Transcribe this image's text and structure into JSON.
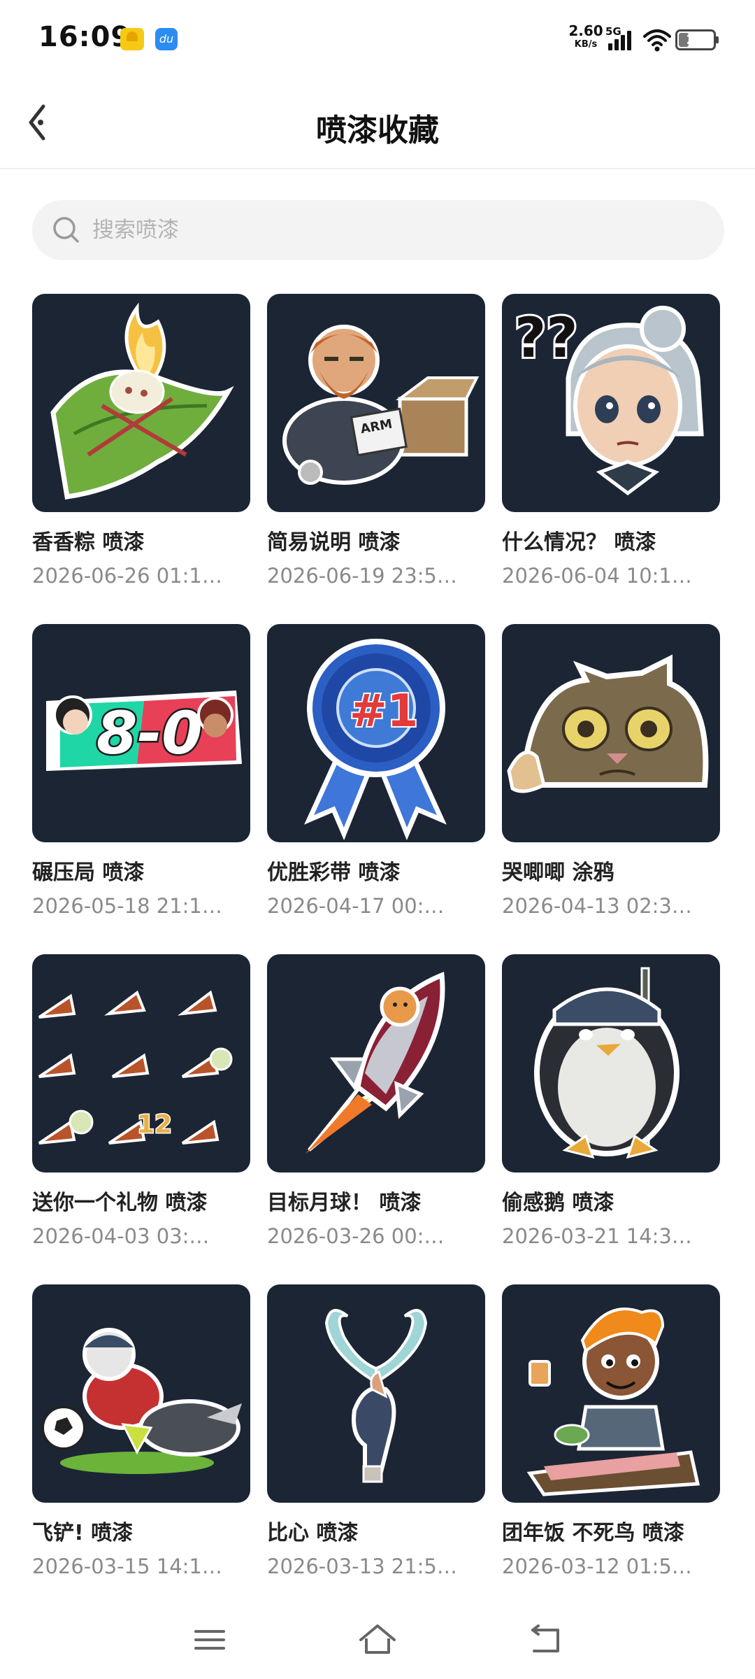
{
  "status_bar": {
    "time": "16:09",
    "net_speed": "2.60",
    "net_unit": "KB/s",
    "network": "5G",
    "battery": "27",
    "battery_percent": 27
  },
  "header": {
    "title": "喷漆收藏",
    "back_icon": "back-arrow-icon"
  },
  "search": {
    "placeholder": "搜索喷漆",
    "value": ""
  },
  "items": [
    {
      "name": "香香粽 喷漆",
      "date": "2026-06-26 01:1…",
      "art": "rice-dumpling-spray"
    },
    {
      "name": "简易说明 喷漆",
      "date": "2026-06-19 23:5…",
      "art": "brimstone-manual-spray"
    },
    {
      "name": "什么情况？ 喷漆",
      "date": "2026-06-04 10:1…",
      "art": "confused-girl-spray"
    },
    {
      "name": "碾压局 喷漆",
      "date": "2026-05-18 21:1…",
      "art": "eight-zero-spray"
    },
    {
      "name": "优胜彩带 喷漆",
      "date": "2026-04-17 00:…",
      "art": "first-place-ribbon-spray"
    },
    {
      "name": "哭唧唧 涂鸦",
      "date": "2026-04-13 02:3…",
      "art": "crying-cat-spray"
    },
    {
      "name": "送你一个礼物 喷漆",
      "date": "2026-04-03 03:…",
      "art": "gift-cones-spray"
    },
    {
      "name": "目标月球！ 喷漆",
      "date": "2026-03-26 00:…",
      "art": "rocket-dog-spray"
    },
    {
      "name": "偷感鹅 喷漆",
      "date": "2026-03-21 14:3…",
      "art": "sneaky-penguin-spray"
    },
    {
      "name": "飞铲! 喷漆",
      "date": "2026-03-15 14:1…",
      "art": "slide-tackle-spray"
    },
    {
      "name": "比心 喷漆",
      "date": "2026-03-13 21:5…",
      "art": "finger-heart-spray"
    },
    {
      "name": "团年饭 不死鸟 喷漆",
      "date": "2026-03-12 01:5…",
      "art": "phoenix-dinner-spray"
    }
  ],
  "sticker_text": {
    "score": "8-0",
    "rank": "#1",
    "arm": "ARM",
    "question": "??",
    "number": "12"
  },
  "nav": {
    "menu_icon": "menu-icon",
    "home_icon": "home-icon",
    "back_icon": "back-icon"
  },
  "colors": {
    "thumb_bg": "#1c2534",
    "accent_green": "#1fd6a6",
    "accent_red": "#e84057"
  }
}
